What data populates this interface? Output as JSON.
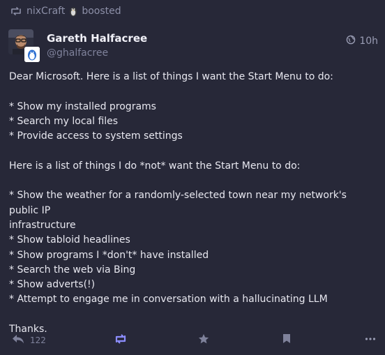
{
  "boost": {
    "account": "nixCraft",
    "label": "boosted"
  },
  "author": {
    "display_name": "Gareth Halfacree",
    "handle": "@ghalfacree"
  },
  "timestamp": "10h",
  "content": {
    "lines": [
      "Dear Microsoft. Here is a list of things I want the Start Menu to do:",
      "",
      "* Show my installed programs",
      "* Search my local files",
      "* Provide access to system settings",
      "",
      "Here is a list of things I do *not* want the Start Menu to do:",
      "",
      "* Show the weather for a randomly-selected town near my network's public IP",
      "infrastructure",
      "* Show tabloid headlines",
      "* Show programs I *don't* have installed",
      "* Search the web via Bing",
      "* Show adverts(!)",
      "* Attempt to engage me in conversation with a hallucinating LLM",
      "",
      "Thanks."
    ]
  },
  "actions": {
    "reply_count": "122"
  },
  "colors": {
    "background": "#272838",
    "boosted_accent": "#8c8dff",
    "muted": "#7f829b"
  }
}
